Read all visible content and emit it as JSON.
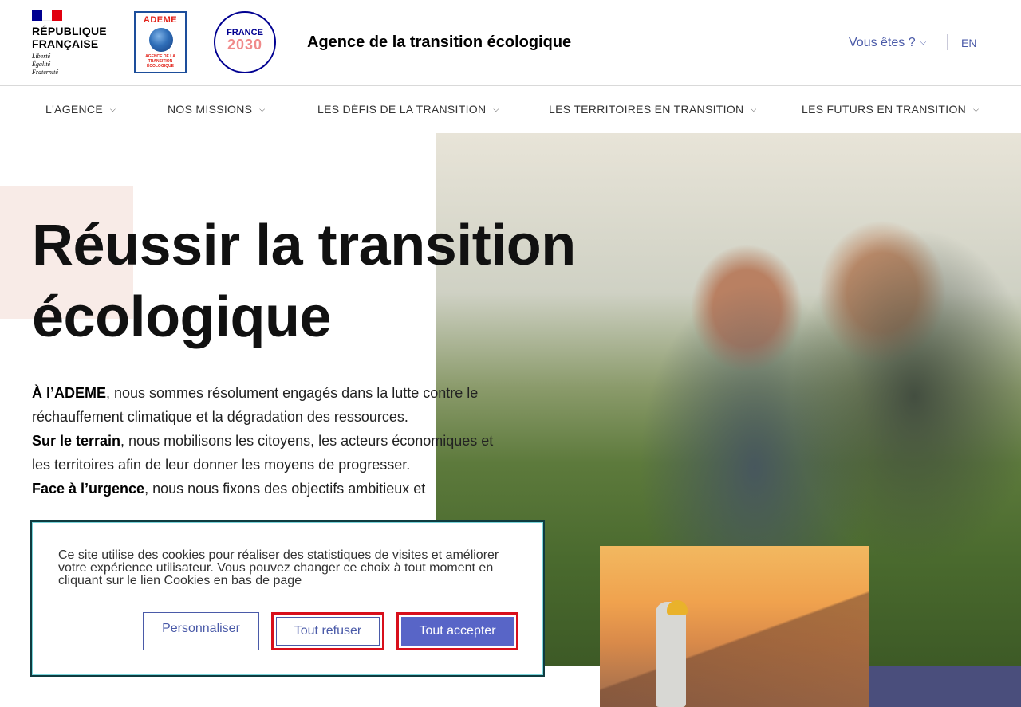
{
  "header": {
    "rf_logo": {
      "line1": "RÉPUBLIQUE",
      "line2": "FRANÇAISE",
      "motto1": "Liberté",
      "motto2": "Égalité",
      "motto3": "Fraternité"
    },
    "ademe_logo": {
      "name": "ADEME",
      "sub1": "AGENCE DE LA",
      "sub2": "TRANSITION",
      "sub3": "ÉCOLOGIQUE"
    },
    "france2030": {
      "line1": "FRANCE",
      "line2": "2030"
    },
    "site_title": "Agence de la transition écologique",
    "who_label": "Vous êtes ?",
    "lang_label": "EN"
  },
  "nav": {
    "items": [
      {
        "label": "L'AGENCE"
      },
      {
        "label": "NOS MISSIONS"
      },
      {
        "label": "LES DÉFIS DE LA TRANSITION"
      },
      {
        "label": "LES TERRITOIRES EN TRANSITION"
      },
      {
        "label": "LES FUTURS EN TRANSITION"
      }
    ]
  },
  "hero": {
    "title_line1": "Réussir la transition",
    "title_line2": "écologique",
    "p1_bold": "À l’ADEME",
    "p1_rest": ", nous sommes résolument engagés dans la lutte contre le réchauffement climatique et la dégradation des ressources.",
    "p2_bold": "Sur le terrain",
    "p2_rest": ", nous mobilisons les citoyens, les acteurs économiques et les territoires afin de leur donner les moyens de progresser.",
    "p3_bold": "Face à l’urgence",
    "p3_rest": ", nous nous fixons des objectifs ambitieux et"
  },
  "cookie": {
    "text": "Ce site utilise des cookies pour réaliser des statistiques de visites et améliorer votre expérience utilisateur. Vous pouvez changer ce choix à tout moment en cliquant sur le lien Cookies en bas de page",
    "personalize_label": "Personnaliser",
    "refuse_label": "Tout refuser",
    "accept_label": "Tout accepter"
  },
  "colors": {
    "accent_blue": "#4a5aa8",
    "accept_button": "#5865c7",
    "highlight_red": "#d80f1b",
    "hero_accent_pink": "#f8ebe7",
    "footer_block": "#4a4e7c"
  }
}
